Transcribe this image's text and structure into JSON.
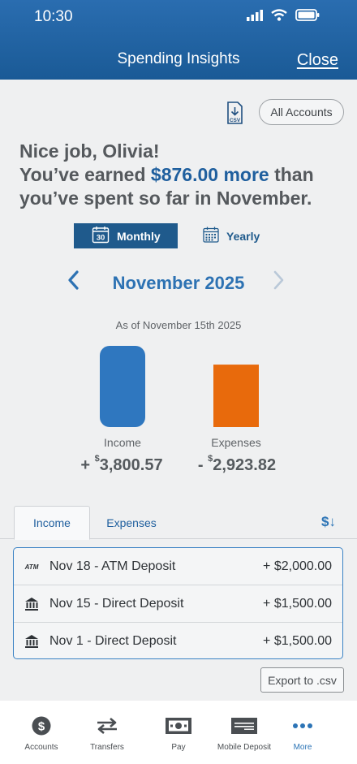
{
  "status": {
    "time": "10:30"
  },
  "header": {
    "title": "Spending Insights",
    "close_label": "Close"
  },
  "toolbar": {
    "csv_icon_label": "CSV",
    "accounts_label": "All Accounts"
  },
  "headline": {
    "line1": "Nice job, Olivia!",
    "prefix": "You’ve earned ",
    "amount": "$876.00 more",
    "suffix": " than you’ve spent so far in November."
  },
  "period": {
    "monthly_label": "Monthly",
    "yearly_label": "Yearly",
    "calendar_day": "30",
    "selected": "Monthly"
  },
  "month_nav": {
    "label": "November 2025"
  },
  "summary": {
    "as_of": "As of November 15th 2025",
    "income": {
      "label": "Income",
      "sign": "+ ",
      "currency": "$",
      "amount": "3,800.57",
      "value": 3800.57,
      "color": "#2f77bf"
    },
    "expenses": {
      "label": "Expenses",
      "sign": "- ",
      "currency": "$",
      "amount": "2,923.82",
      "value": 2923.82,
      "color": "#e86a0c"
    }
  },
  "tabs": {
    "income_label": "Income",
    "expenses_label": "Expenses",
    "active": "Income",
    "sort_icon": "$↓"
  },
  "transactions": [
    {
      "icon": "atm-icon",
      "description": "Nov 18 - ATM Deposit",
      "amount": "+ $2,000.00"
    },
    {
      "icon": "bank-icon",
      "description": "Nov 15 - Direct Deposit",
      "amount": "+ $1,500.00"
    },
    {
      "icon": "bank-icon",
      "description": "Nov 1 - Direct Deposit",
      "amount": "+ $1,500.00"
    }
  ],
  "export_label": "Export to .csv",
  "bottom_nav": [
    {
      "label": "Accounts",
      "icon": "dollar-circle-icon"
    },
    {
      "label": "Transfers",
      "icon": "transfer-arrows-icon"
    },
    {
      "label": "Pay",
      "icon": "cash-icon"
    },
    {
      "label": "Mobile Deposit",
      "icon": "check-deposit-icon"
    },
    {
      "label": "More",
      "icon": "more-dots-icon",
      "active": true
    }
  ]
}
